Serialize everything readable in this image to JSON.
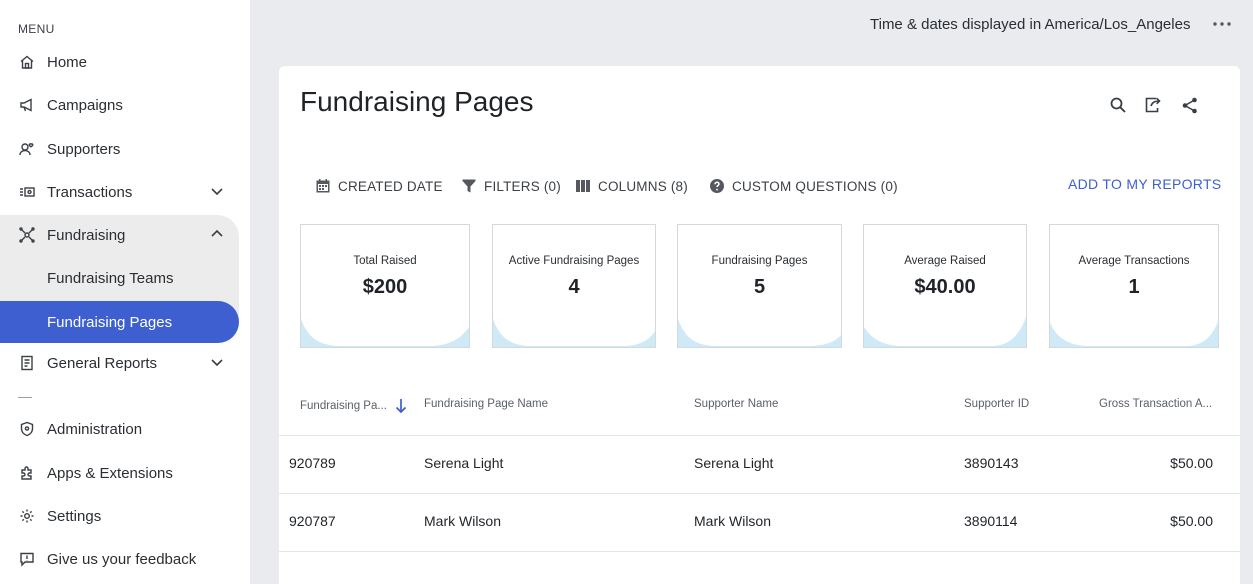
{
  "sidebar": {
    "menu_label": "MENU",
    "items": [
      {
        "label": "Home",
        "icon": "home-icon"
      },
      {
        "label": "Campaigns",
        "icon": "megaphone-icon"
      },
      {
        "label": "Supporters",
        "icon": "supporter-icon"
      },
      {
        "label": "Transactions",
        "icon": "transactions-icon"
      },
      {
        "label": "Fundraising",
        "icon": "fundraising-icon"
      },
      {
        "label": "General Reports",
        "icon": "reports-icon"
      },
      {
        "label": "Administration",
        "icon": "shield-icon"
      },
      {
        "label": "Apps & Extensions",
        "icon": "puzzle-icon"
      },
      {
        "label": "Settings",
        "icon": "gear-icon"
      },
      {
        "label": "Give us your feedback",
        "icon": "feedback-icon"
      }
    ],
    "fundraising_sub": [
      {
        "label": "Fundraising Teams"
      },
      {
        "label": "Fundraising Pages"
      }
    ]
  },
  "topbar": {
    "timezone_text": "Time & dates displayed in America/Los_Angeles"
  },
  "page": {
    "title": "Fundraising Pages"
  },
  "toolbar": {
    "created_date": "CREATED DATE",
    "filters": "FILTERS (0)",
    "columns": "COLUMNS (8)",
    "custom_questions": "CUSTOM QUESTIONS (0)",
    "add_to_reports": "ADD TO MY REPORTS"
  },
  "stats": [
    {
      "label": "Total Raised",
      "value": "$200"
    },
    {
      "label": "Active Fundraising Pages",
      "value": "4"
    },
    {
      "label": "Fundraising Pages",
      "value": "5"
    },
    {
      "label": "Average Raised",
      "value": "$40.00"
    },
    {
      "label": "Average Transactions",
      "value": "1"
    }
  ],
  "table": {
    "columns": [
      "Fundraising Pa...",
      "Fundraising Page Name",
      "Supporter Name",
      "Supporter ID",
      "Gross Transaction A..."
    ],
    "rows": [
      [
        "920789",
        "Serena Light",
        "Serena Light",
        "3890143",
        "$50.00"
      ],
      [
        "920787",
        "Mark Wilson",
        "Mark Wilson",
        "3890114",
        "$50.00"
      ]
    ]
  },
  "colors": {
    "accent": "#3e5fcf",
    "background": "#e9ebee",
    "sparkline_fill": "#cfe9f7"
  }
}
